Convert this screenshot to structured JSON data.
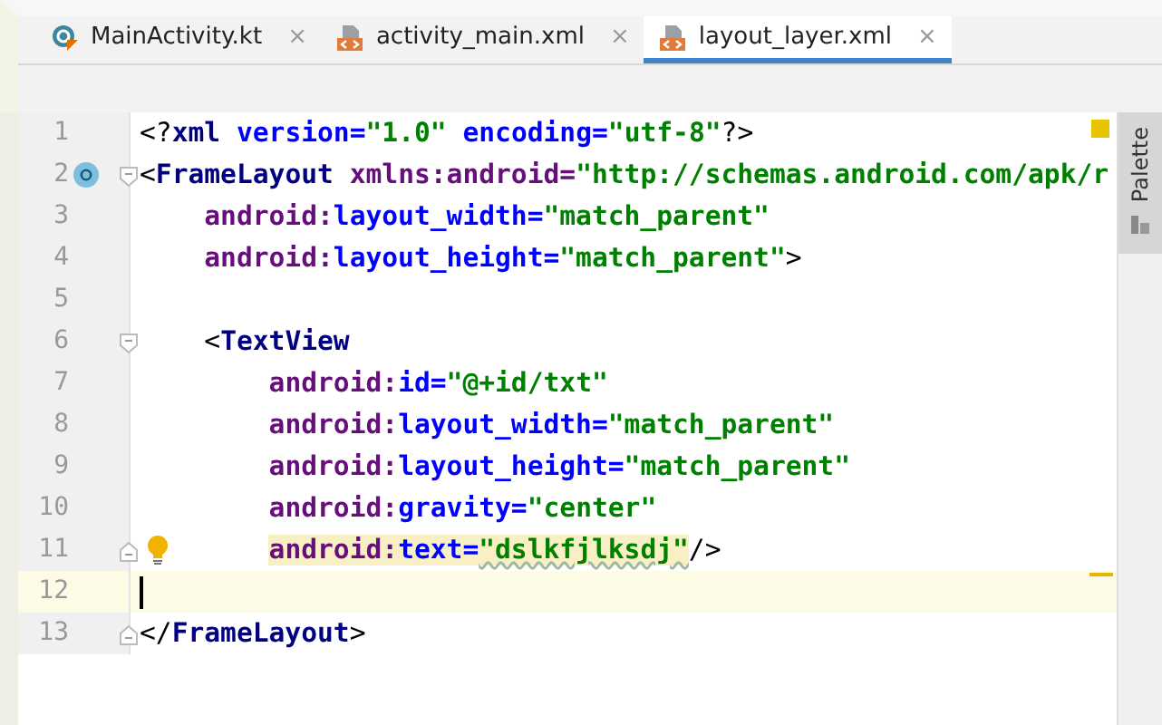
{
  "tabs": [
    {
      "label": "MainActivity.kt",
      "kind": "kotlin",
      "close": "×",
      "selected": false
    },
    {
      "label": "activity_main.xml",
      "kind": "xml",
      "close": "×",
      "selected": false
    },
    {
      "label": "layout_layer.xml",
      "kind": "xml",
      "close": "×",
      "selected": true
    }
  ],
  "editor": {
    "lines": [
      {
        "number": "1",
        "current": false,
        "fold_start": false,
        "fold_end": false,
        "tokens": [
          {
            "text": "<?",
            "kind": "punct",
            "highlighted": false,
            "typo": false
          },
          {
            "text": "xml",
            "kind": "tag",
            "highlighted": false,
            "typo": false
          },
          {
            "text": " version=",
            "kind": "attr",
            "highlighted": false,
            "typo": false
          },
          {
            "text": "\"1.0\"",
            "kind": "value",
            "highlighted": false,
            "typo": false
          },
          {
            "text": " encoding=",
            "kind": "attr",
            "highlighted": false,
            "typo": false
          },
          {
            "text": "\"utf-8\"",
            "kind": "value",
            "highlighted": false,
            "typo": false
          },
          {
            "text": "?>",
            "kind": "punct",
            "highlighted": false,
            "typo": false
          }
        ]
      },
      {
        "number": "2",
        "current": false,
        "kind": "class",
        "fold_start": true,
        "fold_end": false,
        "tokens": [
          {
            "text": "<",
            "kind": "punct",
            "highlighted": false,
            "typo": false
          },
          {
            "text": "FrameLayout",
            "kind": "tag",
            "highlighted": false,
            "typo": false
          },
          {
            "text": " xmlns:android=",
            "kind": "ns",
            "highlighted": false,
            "typo": false
          },
          {
            "text": "\"http://schemas.android.com/apk/r",
            "kind": "value",
            "highlighted": false,
            "typo": false
          }
        ]
      },
      {
        "number": "3",
        "current": false,
        "fold_start": false,
        "fold_end": false,
        "tokens": [
          {
            "text": "    android:",
            "kind": "ns",
            "highlighted": false,
            "typo": false
          },
          {
            "text": "layout_width=",
            "kind": "attr",
            "highlighted": false,
            "typo": false
          },
          {
            "text": "\"match_parent\"",
            "kind": "value",
            "highlighted": false,
            "typo": false
          }
        ]
      },
      {
        "number": "4",
        "current": false,
        "fold_start": false,
        "fold_end": false,
        "tokens": [
          {
            "text": "    android:",
            "kind": "ns",
            "highlighted": false,
            "typo": false
          },
          {
            "text": "layout_height=",
            "kind": "attr",
            "highlighted": false,
            "typo": false
          },
          {
            "text": "\"match_parent\"",
            "kind": "value",
            "highlighted": false,
            "typo": false
          },
          {
            "text": ">",
            "kind": "punct",
            "highlighted": false,
            "typo": false
          }
        ]
      },
      {
        "number": "5",
        "current": false,
        "fold_start": false,
        "fold_end": false
      },
      {
        "number": "6",
        "current": false,
        "fold_start": true,
        "fold_end": false,
        "tokens": [
          {
            "text": "    <",
            "kind": "punct",
            "highlighted": false,
            "typo": false
          },
          {
            "text": "TextView",
            "kind": "tag",
            "highlighted": false,
            "typo": false
          }
        ]
      },
      {
        "number": "7",
        "current": false,
        "fold_start": false,
        "fold_end": false,
        "tokens": [
          {
            "text": "        android:",
            "kind": "ns",
            "highlighted": false,
            "typo": false
          },
          {
            "text": "id=",
            "kind": "attr",
            "highlighted": false,
            "typo": false
          },
          {
            "text": "\"@+id/txt\"",
            "kind": "value",
            "highlighted": false,
            "typo": false
          }
        ]
      },
      {
        "number": "8",
        "current": false,
        "fold_start": false,
        "fold_end": false,
        "tokens": [
          {
            "text": "        android:",
            "kind": "ns",
            "highlighted": false,
            "typo": false
          },
          {
            "text": "layout_width=",
            "kind": "attr",
            "highlighted": false,
            "typo": false
          },
          {
            "text": "\"match_parent\"",
            "kind": "value",
            "highlighted": false,
            "typo": false
          }
        ]
      },
      {
        "number": "9",
        "current": false,
        "fold_start": false,
        "fold_end": false,
        "tokens": [
          {
            "text": "        android:",
            "kind": "ns",
            "highlighted": false,
            "typo": false
          },
          {
            "text": "layout_height=",
            "kind": "attr",
            "highlighted": false,
            "typo": false
          },
          {
            "text": "\"match_parent\"",
            "kind": "value",
            "highlighted": false,
            "typo": false
          }
        ]
      },
      {
        "number": "10",
        "current": false,
        "fold_start": false,
        "fold_end": false,
        "tokens": [
          {
            "text": "        android:",
            "kind": "ns",
            "highlighted": false,
            "typo": false
          },
          {
            "text": "gravity=",
            "kind": "attr",
            "highlighted": false,
            "typo": false
          },
          {
            "text": "\"center\"",
            "kind": "value",
            "highlighted": false,
            "typo": false
          }
        ]
      },
      {
        "number": "11",
        "current": false,
        "kind": "bulb",
        "fold_start": false,
        "fold_end": true,
        "tokens": [
          {
            "text": "        android:",
            "kind": "ns",
            "highlighted": true,
            "typo": false
          },
          {
            "text": "text=",
            "kind": "attr",
            "highlighted": true,
            "typo": false
          },
          {
            "text": "\"dslkfjlksdj\"",
            "kind": "value",
            "highlighted": true,
            "typo": true
          },
          {
            "text": "/>",
            "kind": "punct",
            "highlighted": false,
            "typo": false
          }
        ]
      },
      {
        "number": "12",
        "current": true,
        "fold_start": false,
        "fold_end": false
      },
      {
        "number": "13",
        "current": false,
        "fold_start": false,
        "fold_end": true,
        "tokens": [
          {
            "text": "</",
            "kind": "punct",
            "highlighted": false,
            "typo": false
          },
          {
            "text": "FrameLayout",
            "kind": "tag",
            "highlighted": false,
            "typo": false
          },
          {
            "text": ">",
            "kind": "punct",
            "highlighted": false,
            "typo": false
          }
        ]
      }
    ]
  },
  "side_panel": {
    "label": "Palette"
  }
}
